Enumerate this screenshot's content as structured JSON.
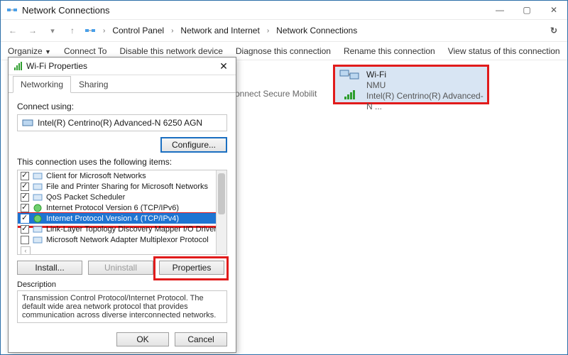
{
  "window": {
    "title": "Network Connections"
  },
  "breadcrumb": {
    "root": "Control Panel",
    "mid": "Network and Internet",
    "leaf": "Network Connections"
  },
  "commands": {
    "organize": "Organize",
    "connect": "Connect To",
    "disable": "Disable this network device",
    "diagnose": "Diagnose this connection",
    "rename": "Rename this connection",
    "status": "View status of this connection",
    "more": "»"
  },
  "wifi_tile": {
    "name": "Wi-Fi",
    "ssid": "NMU",
    "adapter": "Intel(R) Centrino(R) Advanced-N ..."
  },
  "bg_partial": "onnect Secure Mobilit",
  "dialog": {
    "title": "Wi-Fi Properties",
    "tabs": {
      "networking": "Networking",
      "sharing": "Sharing"
    },
    "connect_label": "Connect using:",
    "adapter": "Intel(R) Centrino(R) Advanced-N 6250 AGN",
    "configure": "Configure...",
    "items_label": "This connection uses the following items:",
    "items": [
      {
        "check": true,
        "label": "Client for Microsoft Networks"
      },
      {
        "check": true,
        "label": "File and Printer Sharing for Microsoft Networks"
      },
      {
        "check": true,
        "label": "QoS Packet Scheduler"
      },
      {
        "check": true,
        "label": "Internet Protocol Version 6 (TCP/IPv6)"
      },
      {
        "check": true,
        "label": "Internet Protocol Version 4 (TCP/IPv4)",
        "selected": true
      },
      {
        "check": true,
        "label": "Link-Layer Topology Discovery Mapper I/O Driver"
      },
      {
        "check": false,
        "label": "Microsoft Network Adapter Multiplexor Protocol"
      }
    ],
    "install": "Install...",
    "uninstall": "Uninstall",
    "properties": "Properties",
    "desc_title": "Description",
    "desc_body": "Transmission Control Protocol/Internet Protocol. The default wide area network protocol that provides communication across diverse interconnected networks.",
    "ok": "OK",
    "cancel": "Cancel"
  }
}
